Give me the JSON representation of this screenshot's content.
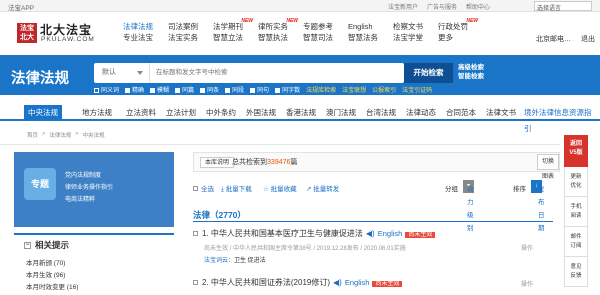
{
  "topbar": {
    "app_label": "法宝APP",
    "links": [
      "法宝新用户",
      "广告与服务",
      "帮助中心"
    ],
    "language": "选择语言"
  },
  "logo": {
    "badge": "法宝北大",
    "cn": "北大法宝",
    "en": "PKULAW.COM"
  },
  "nav": [
    {
      "top": "法律法规",
      "bottom": "专业法宝",
      "active": true,
      "sup": ""
    },
    {
      "top": "司法案例",
      "bottom": "法宝实务",
      "active": false,
      "sup": ""
    },
    {
      "top": "法学期刊",
      "bottom": "智慧立法",
      "active": false,
      "sup": "NEW"
    },
    {
      "top": "律所实务",
      "bottom": "智慧执法",
      "active": false,
      "sup": "NEW"
    },
    {
      "top": "专题参考",
      "bottom": "智慧司法",
      "active": false,
      "sup": ""
    },
    {
      "top": "English",
      "bottom": "智慧法务",
      "active": false,
      "sup": ""
    },
    {
      "top": "检察文书",
      "bottom": "法宝学堂",
      "active": false,
      "sup": ""
    },
    {
      "top": "行政处罚",
      "bottom": "更多",
      "active": false,
      "sup": "NEW"
    }
  ],
  "header_right": {
    "org": "北京邮电…",
    "logout": "退出"
  },
  "band": {
    "title": "法律法规",
    "search_type": "默认",
    "search_placeholder": "在标题和发文字号中检索",
    "search_button": "开始检索",
    "advanced": "高级检索",
    "smart": "智能检索",
    "options": [
      {
        "label": "同义词",
        "checked": true
      },
      {
        "label": "精确",
        "checked": false
      },
      {
        "label": "模糊",
        "checked": false
      },
      {
        "label": "同篇",
        "checked": false
      },
      {
        "label": "同条",
        "checked": false
      },
      {
        "label": "同段",
        "checked": false
      },
      {
        "label": "同句",
        "checked": false
      },
      {
        "label": "同字数",
        "checked": false
      }
    ],
    "extra_links": [
      "法规库检索",
      "法宝联想",
      "公报索引",
      "法宝引证码"
    ]
  },
  "tabs": [
    {
      "label": "中央法规",
      "active": true
    },
    {
      "label": "地方法规",
      "active": false
    },
    {
      "label": "立法资料",
      "active": false
    },
    {
      "label": "立法计划",
      "active": false
    },
    {
      "label": "中外条约",
      "active": false
    },
    {
      "label": "外国法规",
      "active": false
    },
    {
      "label": "香港法规",
      "active": false
    },
    {
      "label": "澳门法规",
      "active": false
    },
    {
      "label": "台湾法规",
      "active": false
    },
    {
      "label": "法律动态",
      "active": false
    },
    {
      "label": "合同范本",
      "active": false
    },
    {
      "label": "法律文书",
      "active": false
    },
    {
      "label": "境外法律信息资源指引",
      "active": false,
      "sup": "NEW"
    }
  ],
  "breadcrumb": [
    "首页",
    ">",
    "法律法规",
    ">",
    "中央法规"
  ],
  "banner": {
    "tag": "专题",
    "lines": [
      "党内法规制度",
      "律师业务操作指引",
      "电商法精粹"
    ]
  },
  "related": {
    "title": "相关提示",
    "rows": [
      "本月新颁 (70)",
      "本月生效 (96)",
      "本月时效变更 (16)"
    ]
  },
  "summary": {
    "explain_button": "本库说明",
    "prefix": "总共检索到",
    "count": "339476",
    "suffix": "篇",
    "switch_button": "切换图表"
  },
  "toolbar": {
    "select_all": "全选",
    "batch_download": "批量下载",
    "batch_fav": "批量收藏",
    "batch_export": "批量转发",
    "group_label": "分组",
    "group_value": "效力级别",
    "sort_label": "排序",
    "sort_value": "发布日期"
  },
  "section": {
    "title": "法律（2770）"
  },
  "results": [
    {
      "title": "1. 中华人民共和国基本医疗卫生与健康促进法",
      "english": "English",
      "badge": "尚未生效",
      "meta": "尚未生效 / 中华人民共和国主席令第38号 / 2019.12.28发布 / 2020.06.01实施",
      "kw_label": "法宝词云：",
      "keywords": "卫生 促进法",
      "op": "操作"
    },
    {
      "title": "2. 中华人民共和国证券法(2019修订)",
      "english": "English",
      "badge": "尚未生效",
      "meta": "",
      "kw_label": "",
      "keywords": "",
      "op": "操作"
    }
  ],
  "rside": {
    "top": [
      "返回",
      "V5版"
    ],
    "buttons": [
      [
        "更新",
        "优化"
      ],
      [
        "手机",
        "阅读"
      ],
      [
        "邮件",
        "订阅"
      ],
      [
        "意见",
        "反馈"
      ]
    ]
  }
}
